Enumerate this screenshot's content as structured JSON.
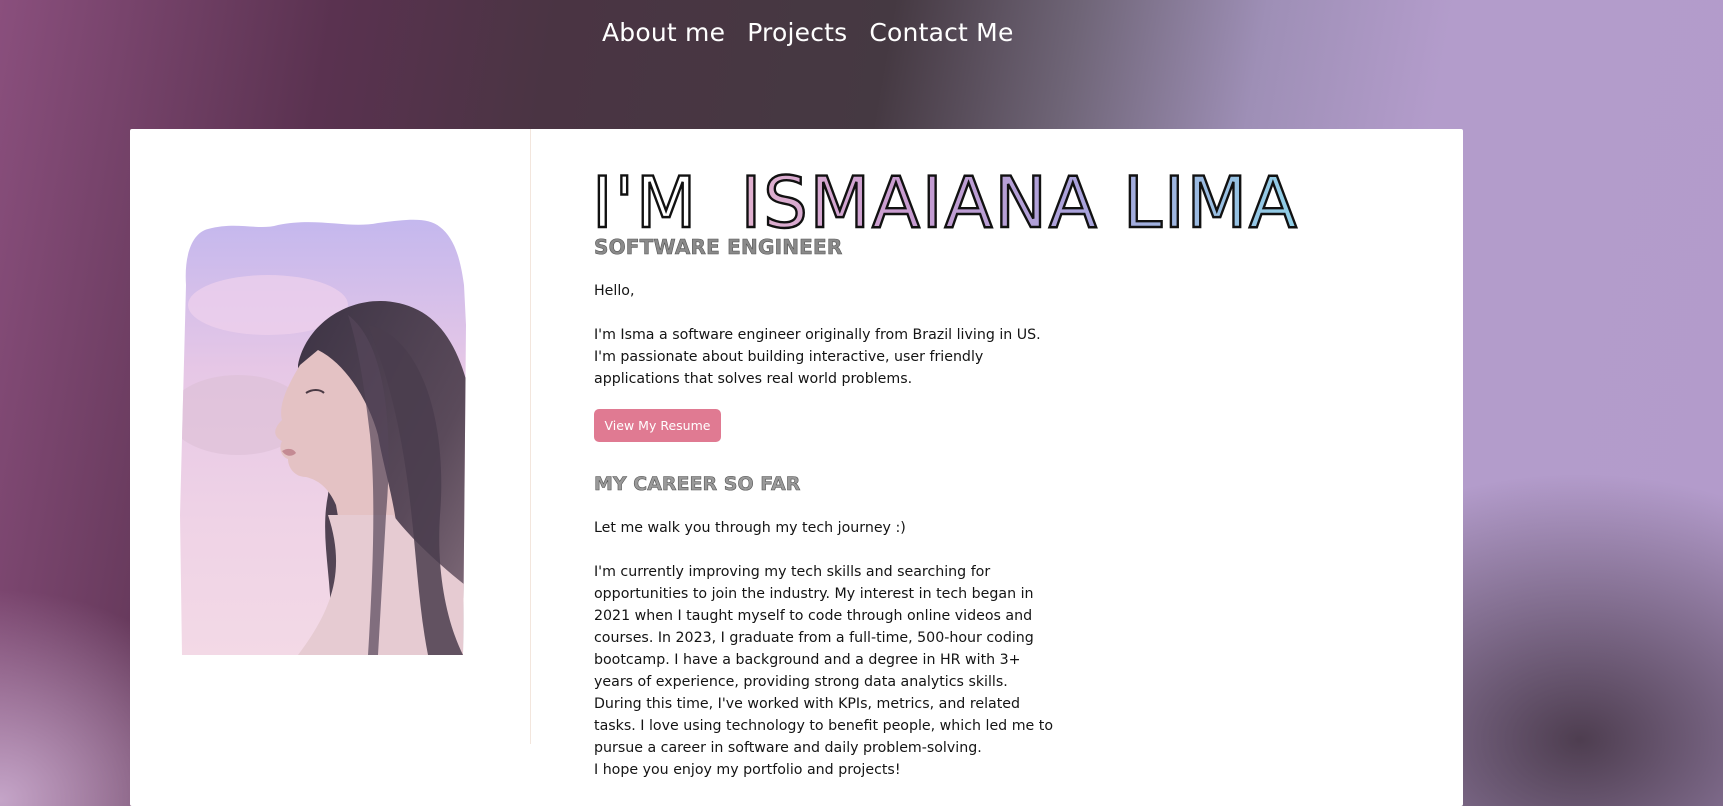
{
  "nav": {
    "about": "About me",
    "projects": "Projects",
    "contact": "Contact Me"
  },
  "hero": {
    "title_prefix": "I'M",
    "title_name": "ISMAIANA LIMA",
    "subtitle": "SOFTWARE ENGINEER",
    "greeting": "Hello,",
    "intro_lines": [
      "I'm Isma a software engineer originally from Brazil living in US.",
      "I'm passionate about building interactive, user friendly",
      "applications that solves real world problems."
    ],
    "resume_button": "View My Resume"
  },
  "career": {
    "heading": "MY CAREER SO FAR",
    "lead": "Let me walk you through my tech journey :)",
    "lines": [
      "I'm currently improving my tech skills and searching for",
      "opportunities to join the industry. My interest in tech began in",
      "2021 when I taught myself to code through online videos and",
      "courses. In 2023, I graduate from a full-time, 500-hour coding",
      "bootcamp. I have a background and a degree in HR with 3+",
      "years of experience, providing strong data analytics skills.",
      "During this time, I've worked with KPIs, metrics, and related",
      "tasks. I love using technology to benefit people, which led me to",
      "pursue a career in software and daily problem-solving.",
      "I hope you enjoy my portfolio and projects!"
    ]
  },
  "colors": {
    "button": "#e07a92",
    "title_gradient": [
      "#e3b3cf",
      "#c79bd0",
      "#a8a3dc",
      "#8fcfe6"
    ]
  }
}
